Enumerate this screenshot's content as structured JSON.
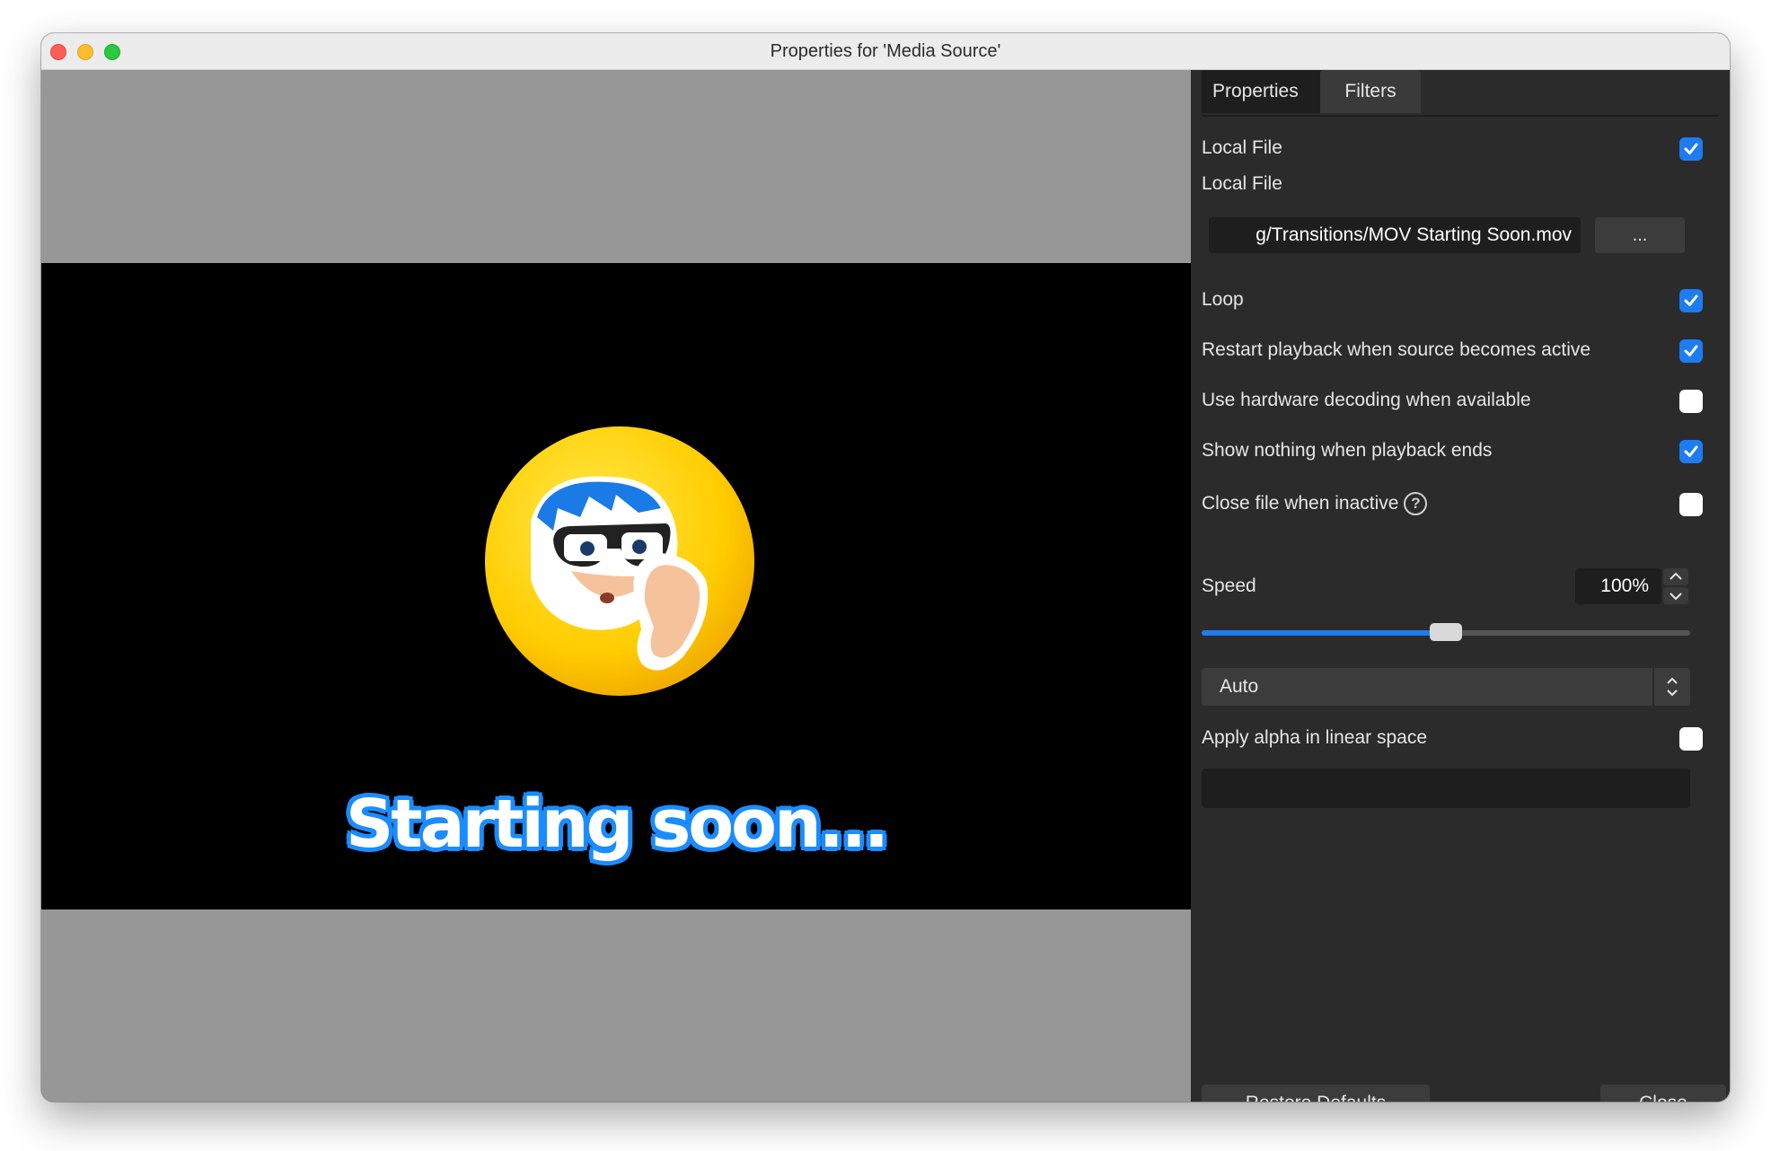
{
  "window": {
    "title": "Properties for 'Media Source'"
  },
  "preview": {
    "overlay_text": "Starting soon..."
  },
  "panel": {
    "tabs": [
      {
        "label": "Properties",
        "active": true
      },
      {
        "label": "Filters",
        "active": false
      }
    ],
    "local_file_toggle": {
      "label": "Local File",
      "checked": true
    },
    "local_file_label": "Local File",
    "local_file_path": "g/Transitions/MOV Starting Soon.mov",
    "browse_label": "...",
    "options": [
      {
        "label": "Loop",
        "checked": true
      },
      {
        "label": "Restart playback when source becomes active",
        "checked": true
      },
      {
        "label": "Use hardware decoding when available",
        "checked": false
      },
      {
        "label": "Show nothing when playback ends",
        "checked": true
      },
      {
        "label": "Close file when inactive",
        "checked": false,
        "help": true
      }
    ],
    "speed": {
      "label": "Speed",
      "value_text": "100%",
      "slider_fraction": 0.5
    },
    "color_range": {
      "selected": "Auto"
    },
    "alpha_linear": {
      "label": "Apply alpha in linear space",
      "checked": false
    },
    "buttons": {
      "restore": "Restore Defaults",
      "close": "Close"
    }
  },
  "colors": {
    "accent": "#1e7cf2",
    "panel_bg": "#2b2b2b",
    "preview_bg": "#979797"
  }
}
